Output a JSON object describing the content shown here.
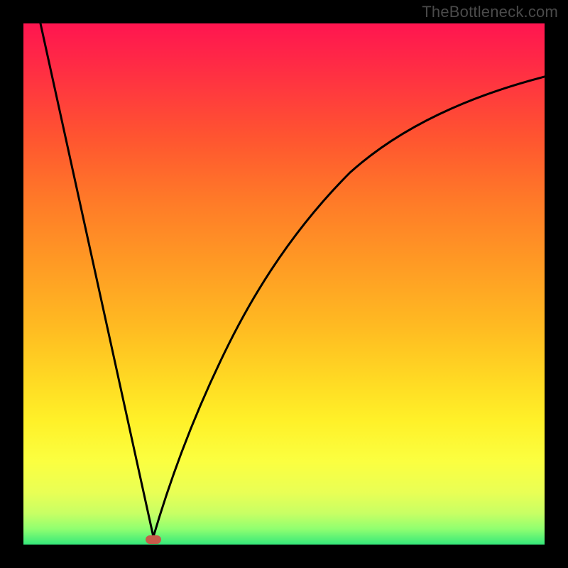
{
  "attribution": "TheBottleneck.com",
  "chart_data": {
    "type": "line",
    "title": "",
    "xlabel": "",
    "ylabel": "",
    "xlim": [
      0,
      100
    ],
    "ylim": [
      0,
      100
    ],
    "x": [
      0,
      4,
      8,
      12,
      16,
      20,
      22.5,
      25,
      28,
      32,
      36,
      40,
      45,
      50,
      55,
      60,
      65,
      70,
      75,
      80,
      85,
      90,
      95,
      100
    ],
    "values": [
      100,
      82,
      64,
      47,
      29,
      12,
      3,
      0,
      10,
      25,
      38,
      47,
      56,
      64,
      70,
      74,
      78,
      81,
      83,
      85,
      87,
      88,
      89,
      90
    ],
    "marker": {
      "x": 25,
      "y": 0
    },
    "background_gradient": {
      "top": "#ff1550",
      "mid": "#ffc822",
      "bottom": "#35e87a"
    }
  }
}
